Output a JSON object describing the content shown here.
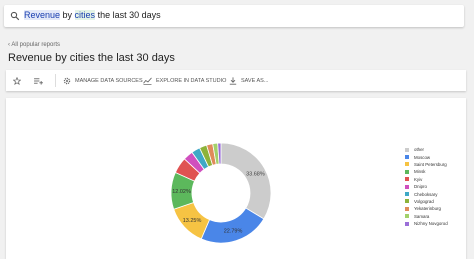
{
  "search": {
    "query_part1": "Revenue",
    "query_part2": " by ",
    "query_part3": "cities",
    "query_part4": " the last 30 days"
  },
  "nav": {
    "back_label": "‹ All popular reports"
  },
  "report": {
    "title": "Revenue by cities the last 30 days"
  },
  "toolbar": {
    "manage_label": "MANAGE DATA SOURCES",
    "explore_label": "EXPLORE IN DATA STUDIO",
    "save_label": "SAVE AS..."
  },
  "chart_data": {
    "type": "pie",
    "categories": [
      "other",
      "Moscow",
      "Saint Petersburg",
      "Minsk",
      "Kyiv",
      "Dnipro",
      "Cheboksary",
      "Volgograd",
      "Yekaterinburg",
      "Samara",
      "Nizhny Novgorod"
    ],
    "values": [
      33.68,
      22.79,
      13.25,
      12.02,
      5.2,
      3.2,
      2.8,
      2.4,
      2.0,
      1.6,
      1.06
    ],
    "colors": [
      "#cccccc",
      "#4a86e8",
      "#f6c343",
      "#5cb85c",
      "#e05252",
      "#d04fbe",
      "#3fa9c6",
      "#8db33a",
      "#e08b5a",
      "#a3d16a",
      "#9b6fd8"
    ],
    "labels": [
      "33.68%",
      "22.79%",
      "13.25%",
      "12.02%",
      "",
      "",
      "",
      "",
      "",
      "",
      ""
    ]
  }
}
